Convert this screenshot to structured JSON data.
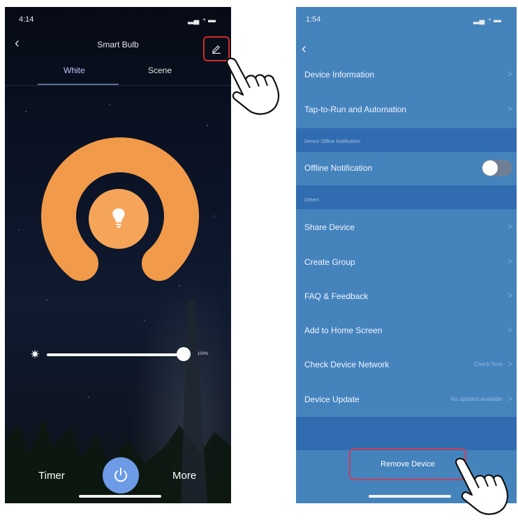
{
  "left_screen": {
    "status_time": "4:14",
    "title": "Smart Bulb",
    "tabs": [
      "White",
      "Scene"
    ],
    "brightness_label": "100%",
    "brightness_level": 1.0,
    "bottom": {
      "timer_label": "Timer",
      "more_label": "More"
    },
    "icons": {
      "back": "chevron-left-icon",
      "edit": "pencil-icon",
      "bulb": "bulb-icon",
      "sun": "sun-icon",
      "power": "power-icon"
    },
    "colors": {
      "ring": "#f09a4a",
      "bulb_circle": "#f5a55a",
      "power_button": "#6d9be6",
      "highlight": "#d22b2b"
    }
  },
  "right_screen": {
    "status_time": "1:54",
    "rows": {
      "device_information": "Device Information",
      "tap_to_run": "Tap-to-Run and Automation",
      "section_offline": "Device Offline Notification",
      "offline_notification": "Offline Notification",
      "section_others": "Others",
      "share_device": "Share Device",
      "create_group": "Create Group",
      "faq": "FAQ & Feedback",
      "add_home": "Add to Home Screen",
      "check_network": "Check Device Network",
      "check_network_value": "Check Now",
      "device_update": "Device Update",
      "device_update_value": "No updates available"
    },
    "remove_device": "Remove Device",
    "chevron": ">",
    "colors": {
      "background": "#4583bd",
      "section": "#316cb0",
      "highlight": "#c9405a"
    }
  }
}
